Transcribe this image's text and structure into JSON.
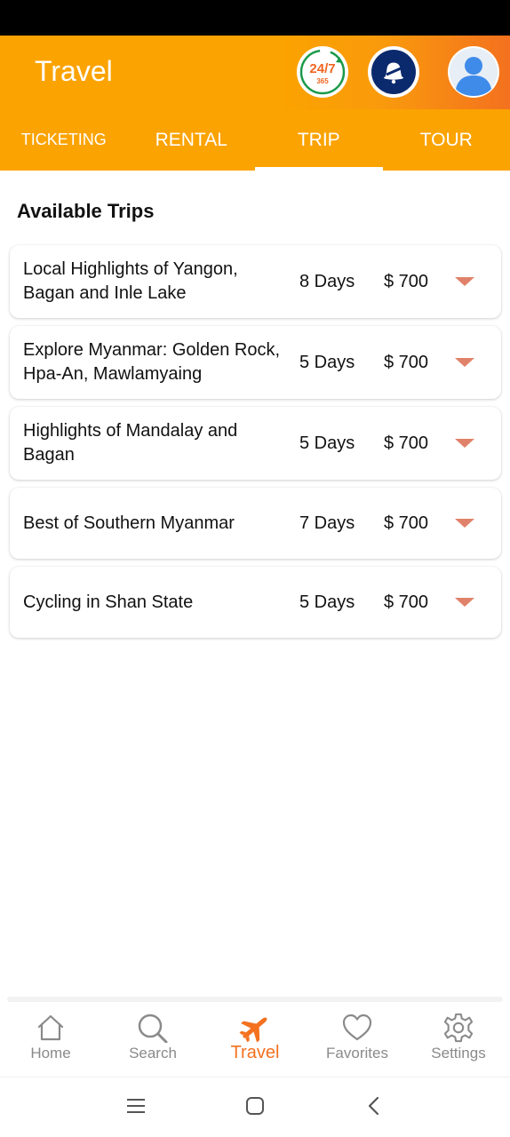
{
  "header": {
    "title": "Travel",
    "badge_247_top": "24/7",
    "badge_247_bottom": "365"
  },
  "tabs": [
    {
      "label": "TICKETING"
    },
    {
      "label": "RENTAL"
    },
    {
      "label": "TRIP"
    },
    {
      "label": "TOUR"
    }
  ],
  "section_title": "Available Trips",
  "trips": [
    {
      "name": "Local Highlights of Yangon, Bagan and Inle Lake",
      "days": "8 Days",
      "price": "$ 700"
    },
    {
      "name": "Explore Myanmar: Golden Rock, Hpa-An, Mawlamyaing",
      "days": "5 Days",
      "price": "$ 700"
    },
    {
      "name": "Highlights of Mandalay and Bagan",
      "days": "5 Days",
      "price": "$ 700"
    },
    {
      "name": "Best of Southern Myanmar",
      "days": "7 Days",
      "price": "$ 700"
    },
    {
      "name": "Cycling in Shan State",
      "days": "5 Days",
      "price": "$ 700"
    }
  ],
  "bottom_nav": [
    {
      "label": "Home",
      "icon": "home-icon"
    },
    {
      "label": "Search",
      "icon": "search-icon"
    },
    {
      "label": "Travel",
      "icon": "airplane-icon"
    },
    {
      "label": "Favorites",
      "icon": "heart-icon"
    },
    {
      "label": "Settings",
      "icon": "gear-icon"
    }
  ],
  "colors": {
    "accent_orange": "#fba300",
    "active_orange": "#f4711f",
    "caret": "#e0826a",
    "inactive_gray": "#8a8a8a"
  },
  "active_tab": "TRIP",
  "active_nav": "Travel"
}
